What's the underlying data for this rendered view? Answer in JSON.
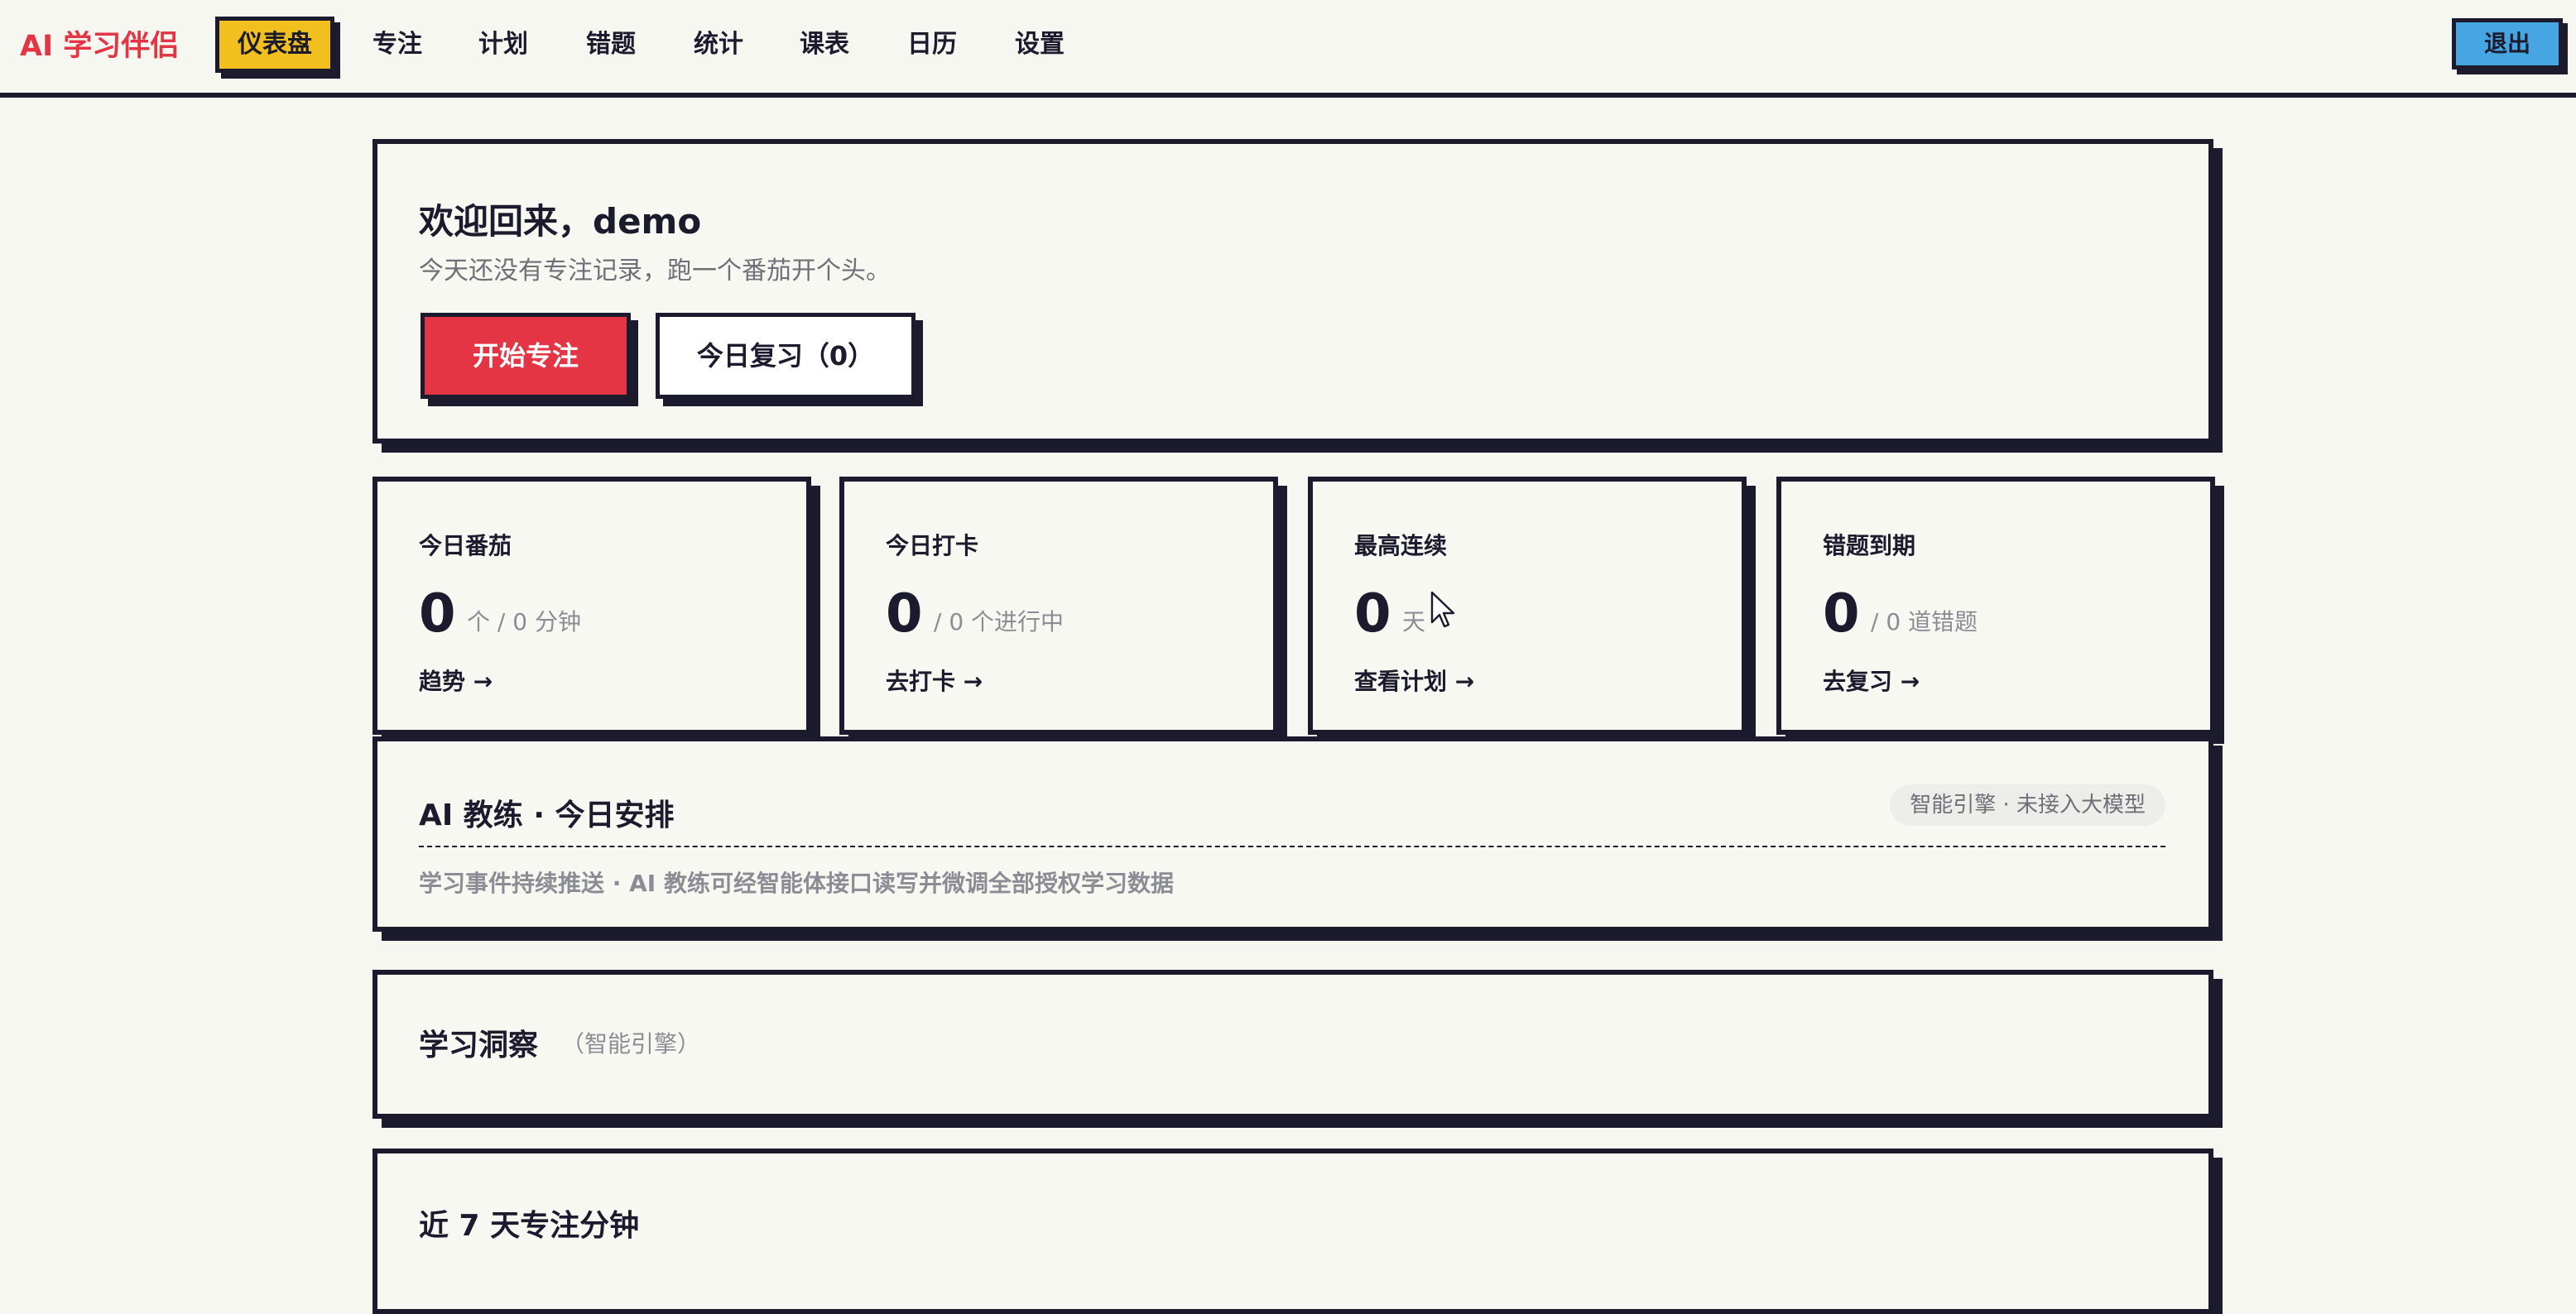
{
  "app": {
    "brand": "AI 学习伴侣",
    "logout_label": "退出"
  },
  "nav": {
    "items": [
      {
        "label": "仪表盘",
        "active": true
      },
      {
        "label": "专注"
      },
      {
        "label": "计划"
      },
      {
        "label": "错题"
      },
      {
        "label": "统计"
      },
      {
        "label": "课表"
      },
      {
        "label": "日历"
      },
      {
        "label": "设置"
      }
    ]
  },
  "welcome": {
    "title": "欢迎回来，demo",
    "subtitle": "今天还没有专注记录，跑一个番茄开个头。",
    "start_focus_label": "开始专注",
    "review_label": "今日复习（0）"
  },
  "stats": [
    {
      "label": "今日番茄",
      "value": "0",
      "unit": "个 / 0 分钟",
      "link": "趋势 →"
    },
    {
      "label": "今日打卡",
      "value": "0",
      "unit": "/ 0 个进行中",
      "link": "去打卡 →"
    },
    {
      "label": "最高连续",
      "value": "0",
      "unit": "天",
      "link": "查看计划 →"
    },
    {
      "label": "错题到期",
      "value": "0",
      "unit": "/ 0 道错题",
      "link": "去复习 →"
    }
  ],
  "coach": {
    "title": "AI 教练 · 今日安排",
    "badge": "智能引擎 · 未接入大模型",
    "description": "学习事件持续推送 · AI 教练可经智能体接口读写并微调全部授权学习数据"
  },
  "insight": {
    "title": "学习洞察",
    "tag": "（智能引擎）"
  },
  "weekly": {
    "title": "近 7 天专注分钟"
  },
  "colors": {
    "brand": "#e43544",
    "active_nav": "#f2c01e",
    "primary_button": "#e43544",
    "logout_button": "#45a6e2",
    "ink": "#1c1b2e",
    "background": "#f7f7f1"
  }
}
